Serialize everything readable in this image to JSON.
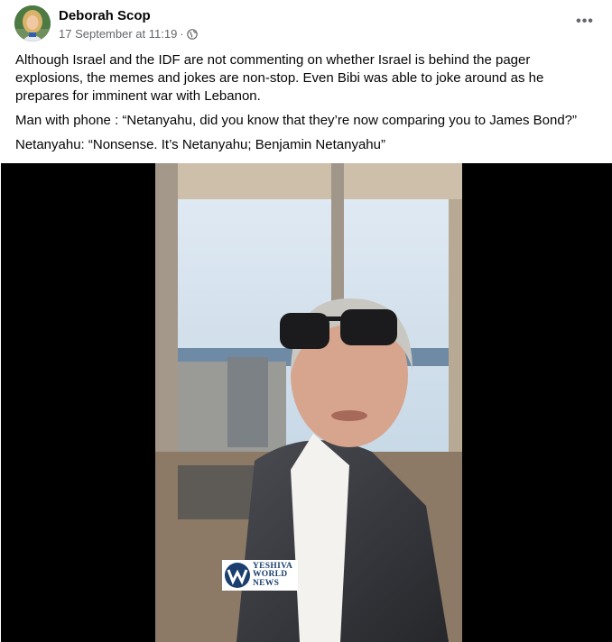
{
  "post": {
    "author": "Deborah Scop",
    "timestamp": "17 September at 11:19",
    "separator": "·",
    "privacy_icon": "globe-icon",
    "more_icon": "more-options-icon",
    "more_label": "•••",
    "paragraphs": [
      "Although Israel and the IDF are not commenting on whether Israel is behind the pager explosions, the memes and jokes are non-stop. Even Bibi was able to joke around as he prepares for imminent war with Lebanon.",
      "Man with phone : “Netanyahu, did you know that they’re now comparing you to James Bond?”",
      "Netanyahu: “Nonsense. It’s Netanyahu; Benjamin Netanyahu”"
    ]
  },
  "video": {
    "watermark": {
      "line1": "YESHIVA",
      "line2": "WORLD",
      "line3": "NEWS"
    }
  },
  "colors": {
    "text_primary": "#050505",
    "text_secondary": "#65676b",
    "video_background": "#000000",
    "watermark_blue": "#1a3f6e"
  }
}
